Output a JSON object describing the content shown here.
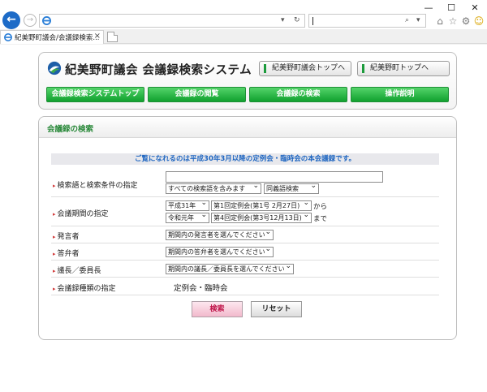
{
  "browser": {
    "tab_title": "紀美野町議会/会議録検索...",
    "tab_close": "×",
    "refresh_icon": "↻",
    "search_icon": "⌕",
    "dropdown_icon": "▾",
    "window_controls": {
      "minimize": "—",
      "maximize": "☐",
      "close": "✕"
    }
  },
  "header": {
    "site_title": "紀美野町議会 会議録検索システム",
    "top_links": [
      "紀美野町議会トップへ",
      "紀美野町トップへ"
    ],
    "nav_buttons": [
      "会議録検索システムトップ",
      "会議録の閲覧",
      "会議録の検索",
      "操作説明"
    ],
    "brand_color": "#10a02e"
  },
  "search_panel": {
    "title": "会議録の検索",
    "notice": "ご覧になれるのは平成30年3月以降の定例会・臨時会の本会議録です。",
    "rows": [
      {
        "label": "検索語と検索条件の指定"
      },
      {
        "label": "会議期間の指定"
      },
      {
        "label": "発言者"
      },
      {
        "label": "答弁者"
      },
      {
        "label": "議長／委員長"
      },
      {
        "label": "会議録種類の指定"
      }
    ],
    "keyword": {
      "value": "",
      "condition": "すべての検索語を含みます",
      "synonym": "同義語検索"
    },
    "period": {
      "from_era": "平成31年",
      "from_session": "第1回定例会(第1号 2月27日)",
      "from_suffix": "から",
      "to_era": "令和元年",
      "to_session": "第4回定例会(第3号12月13日)",
      "to_suffix": "まで"
    },
    "speaker": "期間内の発言者を選んでください",
    "responder": "期間内の答弁者を選んでください",
    "chair": "期間内の議長／委員長を選んでください",
    "record_type": "定例会・臨時会",
    "search_button": "検索",
    "reset_button": "リセット"
  }
}
